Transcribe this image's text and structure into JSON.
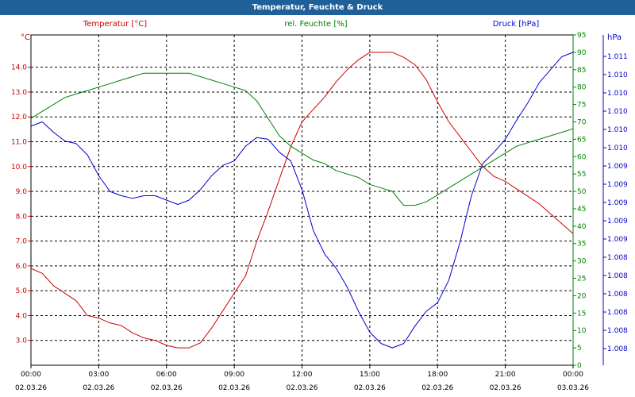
{
  "title": "Temperatur, Feuchte & Druck",
  "chart_data": {
    "type": "line",
    "title": "Temperatur, Feuchte & Druck",
    "grid": true,
    "x_ticks": [
      {
        "time": "00:00",
        "date": "02.03.26"
      },
      {
        "time": "03:00",
        "date": "02.03.26"
      },
      {
        "time": "06:00",
        "date": "02.03.26"
      },
      {
        "time": "09:00",
        "date": "02.03.26"
      },
      {
        "time": "12:00",
        "date": "02.03.26"
      },
      {
        "time": "15:00",
        "date": "02.03.26"
      },
      {
        "time": "18:00",
        "date": "02.03.26"
      },
      {
        "time": "21:00",
        "date": "02.03.26"
      },
      {
        "time": "00:00",
        "date": "03.03.26"
      }
    ],
    "x_range_hours": [
      0,
      24
    ],
    "axes": {
      "temp": {
        "label": "Temperatur [°C]",
        "unit": "°C",
        "color": "#cc0000",
        "range": [
          2.0,
          15.3
        ],
        "ticks": [
          "3.0",
          "4.0",
          "5.0",
          "6.0",
          "7.0",
          "8.0",
          "9.0",
          "10.0",
          "11.0",
          "12.0",
          "13.0",
          "14.0"
        ]
      },
      "hum": {
        "label": "rel. Feuchte [%]",
        "unit": "%",
        "color": "#008000",
        "range": [
          0,
          95
        ],
        "ticks": [
          "0",
          "5",
          "10",
          "15",
          "20",
          "25",
          "30",
          "35",
          "40",
          "45",
          "50",
          "55",
          "60",
          "65",
          "70",
          "75",
          "80",
          "85",
          "90",
          "95"
        ]
      },
      "press": {
        "label": "Druck [hPa]",
        "unit": "hPa",
        "color": "#0000cc",
        "range": [
          1007.6,
          1011.4
        ],
        "ticks": [
          "1.008",
          "1.008",
          "1.008",
          "1.008",
          "1.008",
          "1.008",
          "1.009",
          "1.009",
          "1.009",
          "1.009",
          "1.009",
          "1.010",
          "1.010",
          "1.010",
          "1.010",
          "1.010",
          "1.011"
        ]
      }
    },
    "series": [
      {
        "name": "Temperatur [°C]",
        "axis": "temp",
        "color": "#cc0000",
        "x": [
          0,
          0.5,
          1,
          1.5,
          2,
          2.5,
          3,
          3.5,
          4,
          4.5,
          5,
          5.5,
          6,
          6.5,
          7,
          7.5,
          8,
          8.5,
          9,
          9.5,
          10,
          10.5,
          11,
          11.5,
          12,
          12.5,
          13,
          13.5,
          14,
          14.5,
          15,
          15.5,
          16,
          16.5,
          17,
          17.5,
          18,
          18.5,
          19,
          19.5,
          20,
          20.5,
          21,
          21.5,
          22,
          22.5,
          23,
          23.5,
          24
        ],
        "values": [
          5.9,
          5.7,
          5.2,
          4.9,
          4.6,
          4.0,
          3.9,
          3.7,
          3.6,
          3.3,
          3.1,
          3.0,
          2.8,
          2.7,
          2.7,
          2.9,
          3.5,
          4.2,
          4.9,
          5.6,
          7.0,
          8.2,
          9.5,
          10.8,
          11.8,
          12.3,
          12.8,
          13.4,
          13.9,
          14.3,
          14.6,
          14.6,
          14.6,
          14.4,
          14.1,
          13.5,
          12.6,
          11.8,
          11.2,
          10.6,
          10.0,
          9.6,
          9.4,
          9.1,
          8.8,
          8.5,
          8.1,
          7.7,
          7.3
        ]
      },
      {
        "name": "rel. Feuchte [%]",
        "axis": "hum",
        "color": "#008000",
        "x": [
          0,
          0.5,
          1,
          1.5,
          2,
          2.5,
          3,
          3.5,
          4,
          4.5,
          5,
          5.5,
          6,
          6.5,
          7,
          7.5,
          8,
          8.5,
          9,
          9.5,
          10,
          10.5,
          11,
          11.5,
          12,
          12.5,
          13,
          13.5,
          14,
          14.5,
          15,
          15.5,
          16,
          16.5,
          17,
          17.5,
          18,
          18.5,
          19,
          19.5,
          20,
          20.5,
          21,
          21.5,
          22,
          22.5,
          23,
          23.5,
          24
        ],
        "values": [
          71,
          73,
          75,
          77,
          78,
          79,
          80,
          81,
          82,
          83,
          84,
          84,
          84,
          84,
          84,
          83,
          82,
          81,
          80,
          79,
          76,
          71,
          66,
          63,
          61,
          59,
          58,
          56,
          55,
          54,
          52,
          51,
          50,
          46,
          46,
          47,
          49,
          51,
          53,
          55,
          57,
          59,
          61,
          63,
          64,
          65,
          66,
          67,
          68
        ]
      },
      {
        "name": "Druck [hPa]",
        "axis": "press",
        "color": "#0000cc",
        "x": [
          0,
          0.5,
          1,
          1.5,
          2,
          2.5,
          3,
          3.5,
          4,
          4.5,
          5,
          5.5,
          6,
          6.5,
          7,
          7.5,
          8,
          8.5,
          9,
          9.5,
          10,
          10.5,
          11,
          11.5,
          12,
          12.5,
          13,
          13.5,
          14,
          14.5,
          15,
          15.5,
          16,
          16.5,
          17,
          17.5,
          18,
          18.5,
          19,
          19.5,
          20,
          20.5,
          21,
          21.5,
          22,
          22.5,
          23,
          23.5,
          24
        ],
        "values": [
          1010.35,
          1010.4,
          1010.28,
          1010.18,
          1010.15,
          1010.02,
          1009.78,
          1009.6,
          1009.55,
          1009.52,
          1009.55,
          1009.55,
          1009.5,
          1009.45,
          1009.5,
          1009.62,
          1009.78,
          1009.9,
          1009.95,
          1010.12,
          1010.22,
          1010.2,
          1010.05,
          1009.95,
          1009.62,
          1009.15,
          1008.88,
          1008.72,
          1008.5,
          1008.22,
          1007.98,
          1007.85,
          1007.8,
          1007.85,
          1008.05,
          1008.22,
          1008.32,
          1008.58,
          1009.02,
          1009.55,
          1009.92,
          1010.05,
          1010.2,
          1010.42,
          1010.62,
          1010.85,
          1011.0,
          1011.15,
          1011.2
        ]
      }
    ]
  }
}
